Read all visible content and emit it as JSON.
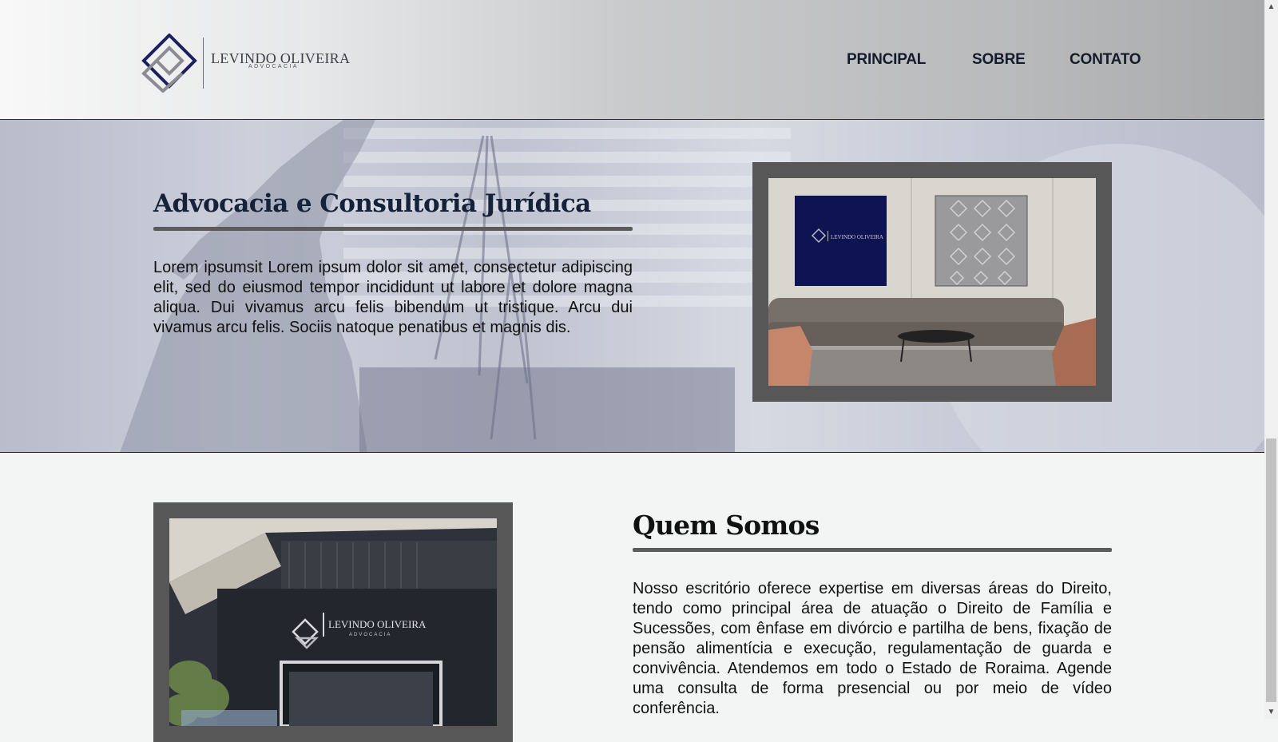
{
  "header": {
    "logo": {
      "name": "LEVINDO OLIVEIRA",
      "subtitle": "ADVOCACIA"
    },
    "nav": [
      {
        "label": "PRINCIPAL"
      },
      {
        "label": "SOBRE"
      },
      {
        "label": "CONTATO"
      }
    ]
  },
  "hero": {
    "title": "Advocacia e Consultoria Jurídica",
    "text": "Lorem ipsumsit Lorem ipsum dolor sit amet, consectetur adipiscing elit, sed do eiusmod tempor incididunt ut labore et dolore magna aliqua. Dui vivamus arcu felis bibendum ut tristique. Arcu dui vivamus arcu felis. Sociis natoque penatibus et magnis dis.",
    "image_logo_text": "LEVINDO OLIVEIRA"
  },
  "about": {
    "title": "Quem Somos",
    "text": "Nosso escritório oferece expertise em diversas áreas do Direito, tendo como principal área de atuação o Direito de Família e Sucessões, com ênfase em divórcio e partilha de bens, fixação de pensão alimentícia e execução, regulamentação de guarda e convivência. Atendemos em todo o Estado de Roraima. Agende uma consulta de forma presencial ou por meio de vídeo conferência.",
    "image_logo_text": "LEVINDO OLIVEIRA",
    "image_logo_sub": "ADVOCACIA"
  },
  "colors": {
    "nav_text": "#141c2b",
    "title_text": "#16223a",
    "frame": "#575757",
    "rule": "#5b5b5b",
    "logo_navy": "#1d1f5e",
    "page_bg": "#f3f5f4"
  },
  "icons": [
    "logo-mark-icon",
    "scroll-up-arrow-icon",
    "scroll-down-arrow-icon"
  ]
}
